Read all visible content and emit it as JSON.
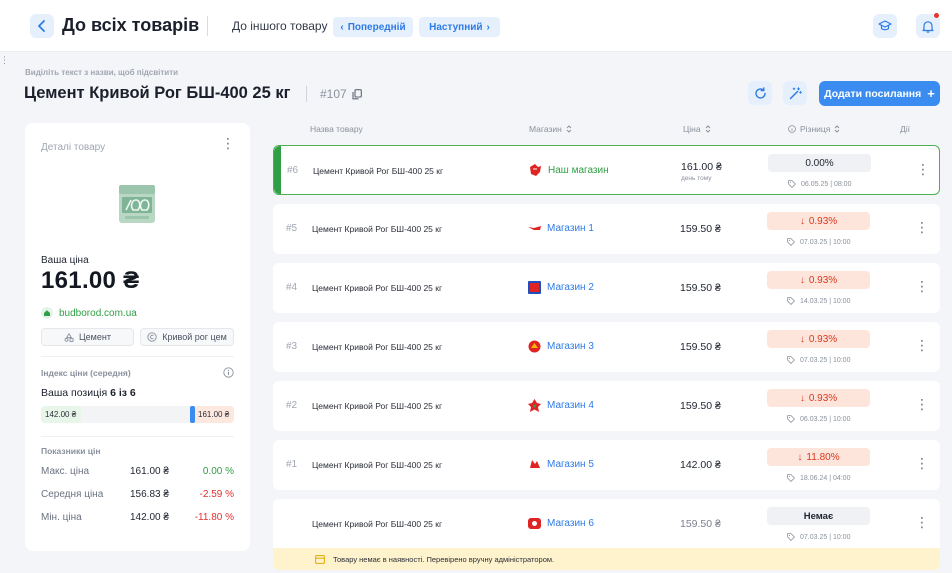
{
  "header": {
    "back_title": "До всіх товарів",
    "other_label": "До іншого товару",
    "prev_label": "Попередній",
    "next_label": "Наступний"
  },
  "page": {
    "hint": "Виділіть текст з назви, щоб підсвітити",
    "title": "Цемент Кривой Рог БШ-400 25 кг",
    "id": "#107",
    "add_link_label": "Додати посилання"
  },
  "card": {
    "label": "Деталі товару",
    "your_price_label": "Ваша ціна",
    "price": "161.00 ₴",
    "domain": "budborod.com.ua",
    "tags": [
      "Цемент",
      "Кривой рог цем"
    ],
    "index_label": "Індекс ціни (середня)",
    "position_prefix": "Ваша позиція",
    "position_value": "6 із 6",
    "range_min": "142.00 ₴",
    "range_max": "161.00 ₴",
    "range_position": 0.79,
    "stats_label": "Показники цін",
    "stats": [
      {
        "name": "Макс. ціна",
        "value": "161.00 ₴",
        "diff": "0.00 %"
      },
      {
        "name": "Середня ціна",
        "value": "156.83 ₴",
        "diff": "-2.59 %"
      },
      {
        "name": "Мін. ціна",
        "value": "142.00 ₴",
        "diff": "-11.80 %"
      }
    ]
  },
  "table": {
    "columns": {
      "name": "Назва товару",
      "store": "Магазин",
      "price": "Ціна",
      "diff": "Різниця",
      "actions": "Дії"
    },
    "rows": [
      {
        "num": "#6",
        "name": "Цемент Кривой Рог БШ-400 25 кг",
        "store": "Наш магазин",
        "price": "161.00 ₴",
        "sub": "день тому",
        "diff": "0.00%",
        "date": "06.05.25 | 08:00"
      },
      {
        "num": "#5",
        "name": "Цемент Кривой Рог БШ-400 25 кг",
        "store": "Магазин 1",
        "price": "159.50 ₴",
        "diff": "0.93%",
        "date": "07.03.25 | 10:00"
      },
      {
        "num": "#4",
        "name": "Цемент Кривой Рог БШ-400 25 кг",
        "store": "Магазин 2",
        "price": "159.50 ₴",
        "diff": "0.93%",
        "date": "14.03.25 | 10:00"
      },
      {
        "num": "#3",
        "name": "Цемент Кривой Рог БШ-400 25 кг",
        "store": "Магазин 3",
        "price": "159.50 ₴",
        "diff": "0.93%",
        "date": "07.03.25 | 10:00"
      },
      {
        "num": "#2",
        "name": "Цемент Кривой Рог БШ-400 25 кг",
        "store": "Магазин 4",
        "price": "159.50 ₴",
        "diff": "0.93%",
        "date": "06.03.25 | 10:00"
      },
      {
        "num": "#1",
        "name": "Цемент Кривой Рог БШ-400 25 кг",
        "store": "Магазин 5",
        "price": "142.00 ₴",
        "diff": "11.80%",
        "date": "18.06.24 | 04:00"
      },
      {
        "num": "",
        "name": "Цемент Кривой Рог БШ-400 25 кг",
        "store": "Магазин 6",
        "price": "159.50 ₴",
        "diff": "Немає",
        "date": "07.03.25 | 10:00"
      }
    ],
    "notice": "Товару немає в наявності. Перевірено вручну адміністратором."
  },
  "colors": {
    "accent": "#3b8cf0",
    "own_green": "#2f9e44",
    "increase_red": "#d9381e",
    "notice_bg": "#fff3cd"
  }
}
